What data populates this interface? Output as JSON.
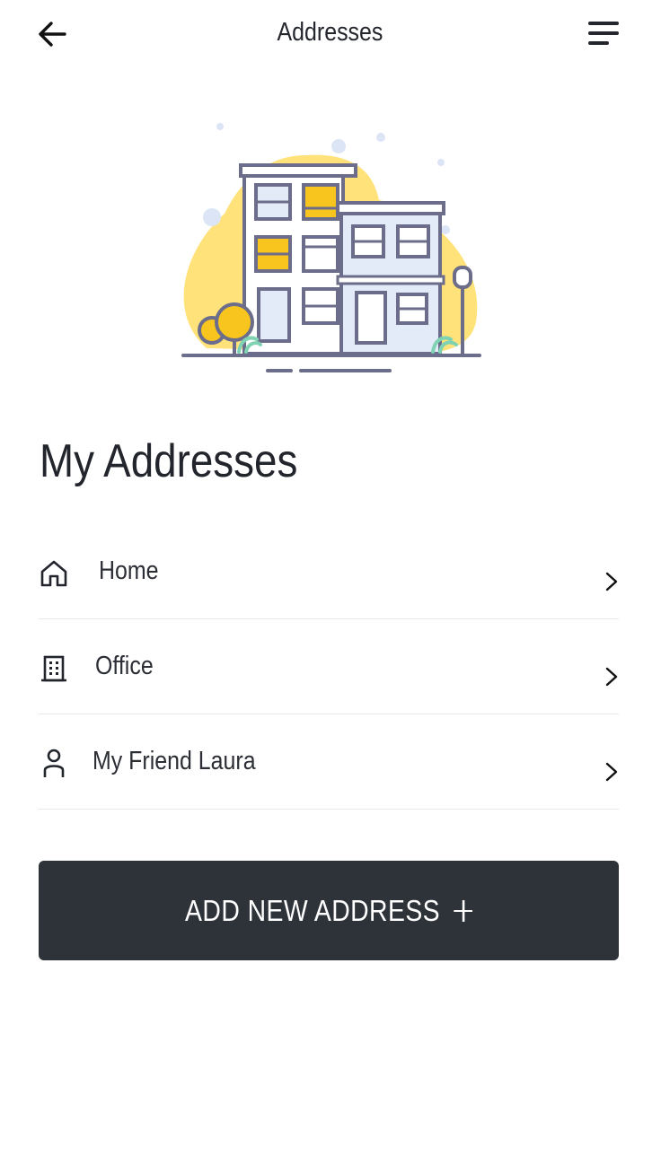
{
  "header": {
    "title": "Addresses",
    "back_icon": "arrow-left-icon",
    "menu_icon": "menu-lines-icon"
  },
  "illustration": {
    "name": "buildings-illustration",
    "colors": {
      "accent": "#FFE27A",
      "yellow": "#F8C41E",
      "outline": "#6B6D8A",
      "fill": "#E3EAF8"
    }
  },
  "main": {
    "heading": "My Addresses"
  },
  "addresses": [
    {
      "label": "Home",
      "icon": "home-icon"
    },
    {
      "label": "Office",
      "icon": "building-icon"
    },
    {
      "label": "My Friend Laura",
      "icon": "person-icon"
    }
  ],
  "actions": {
    "add_label": "ADD NEW ADDRESS",
    "add_icon": "plus-icon",
    "button_color": "#2E3239"
  }
}
